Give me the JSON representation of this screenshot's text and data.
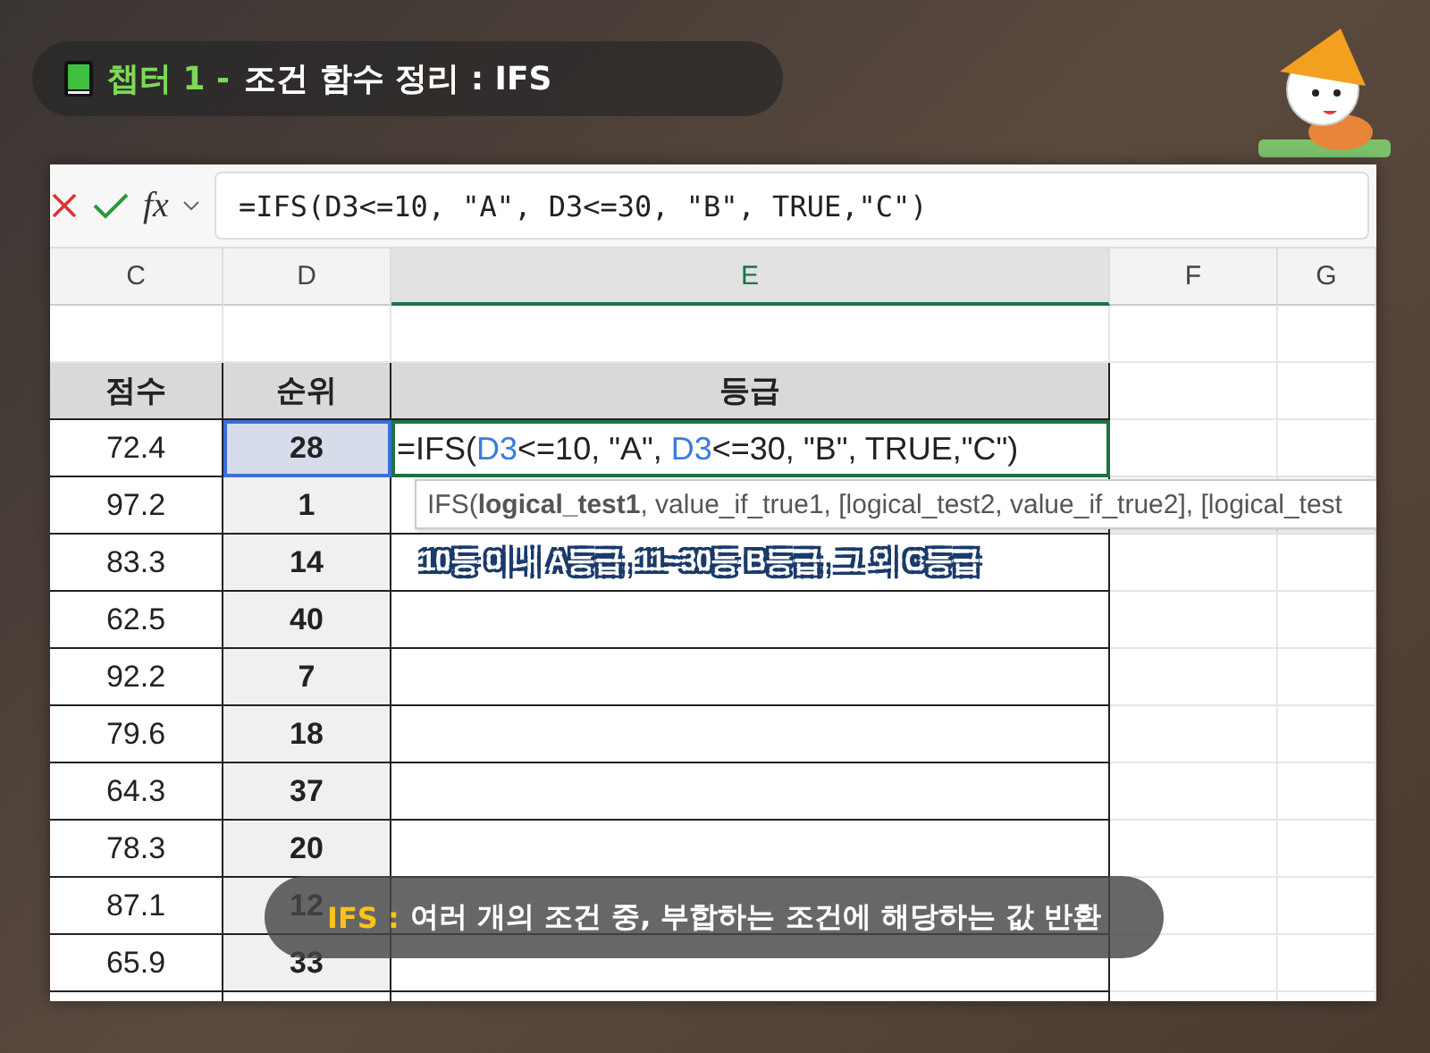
{
  "title": {
    "chapter": "챕터 1 -",
    "topic": "조건 함수 정리 : IFS"
  },
  "formula_bar": {
    "fx_label": "fx",
    "formula": "=IFS(D3<=10, \"A\", D3<=30, \"B\", TRUE,\"C\")"
  },
  "columns": [
    {
      "label": "C",
      "selected": false
    },
    {
      "label": "D",
      "selected": false
    },
    {
      "label": "E",
      "selected": true
    },
    {
      "label": "F",
      "selected": false
    },
    {
      "label": "G",
      "selected": false
    }
  ],
  "table": {
    "headers": [
      "점수",
      "순위",
      "등급"
    ],
    "rows": [
      {
        "score": "72.4",
        "rank": "28",
        "selected": true
      },
      {
        "score": "97.2",
        "rank": "1",
        "selected": false
      },
      {
        "score": "83.3",
        "rank": "14",
        "selected": false
      },
      {
        "score": "62.5",
        "rank": "40",
        "selected": false
      },
      {
        "score": "92.2",
        "rank": "7",
        "selected": false
      },
      {
        "score": "79.6",
        "rank": "18",
        "selected": false
      },
      {
        "score": "64.3",
        "rank": "37",
        "selected": false
      },
      {
        "score": "78.3",
        "rank": "20",
        "selected": false
      },
      {
        "score": "87.1",
        "rank": "12",
        "selected": false
      },
      {
        "score": "65.9",
        "rank": "33",
        "selected": false
      }
    ]
  },
  "cell_edit": {
    "parts": [
      {
        "text": "=IFS(",
        "ref": false
      },
      {
        "text": "D3",
        "ref": true
      },
      {
        "text": "<=10, \"A\", ",
        "ref": false
      },
      {
        "text": "D3",
        "ref": true
      },
      {
        "text": "<=30, \"B\", TRUE,\"C\")",
        "ref": false
      }
    ]
  },
  "tooltip": "IFS(**logical_test1**, value_if_true1, [logical_test2, value_if_true2], [logical_test",
  "caption": "10등 이내 A등급, 11~30등 B등급, 그 외 C등급",
  "subtitle": {
    "keyword": "IFS :",
    "text": "여러 개의 조건 중, 부합하는 조건에 해당하는 값 반환"
  }
}
